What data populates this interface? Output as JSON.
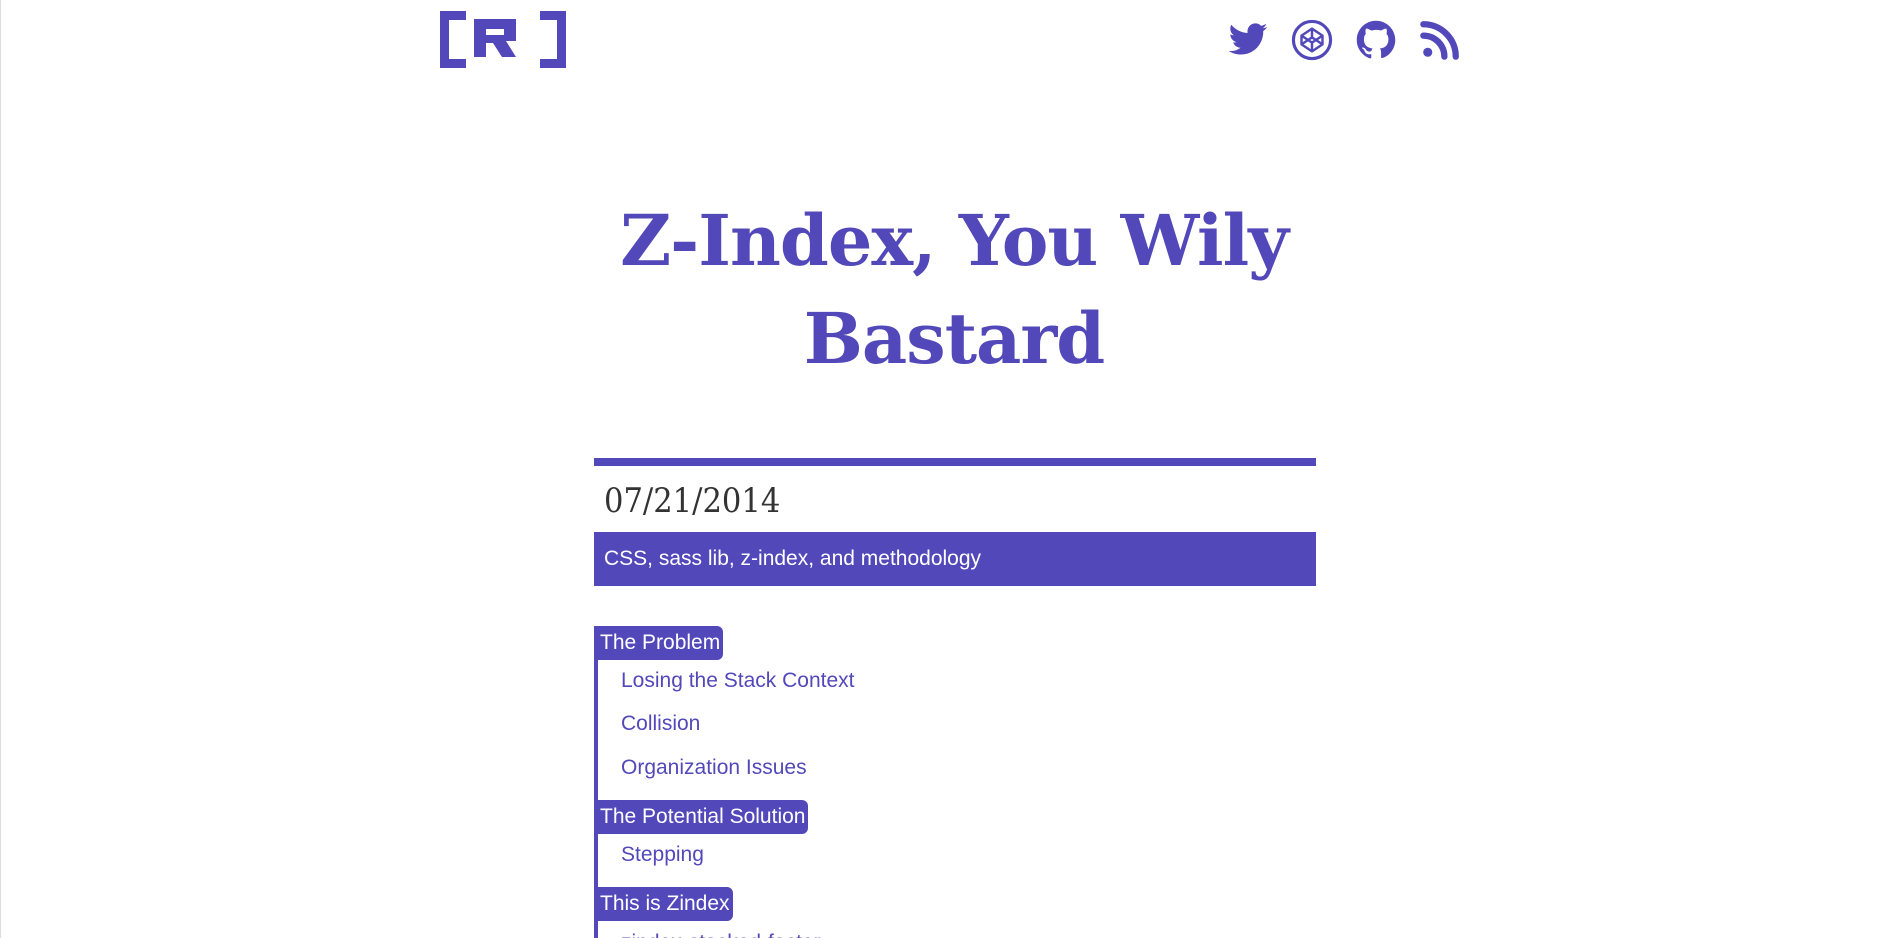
{
  "header": {
    "logo_label": "CR",
    "social": [
      {
        "name": "twitter",
        "icon": "twitter-icon"
      },
      {
        "name": "codepen",
        "icon": "codepen-icon"
      },
      {
        "name": "github",
        "icon": "github-icon"
      },
      {
        "name": "rss",
        "icon": "rss-icon"
      }
    ]
  },
  "colors": {
    "accent": "#5248ba",
    "text_dark": "#333333",
    "background": "#ffffff"
  },
  "post": {
    "title_line1": "Z-Index, You Wily",
    "title_line2": "Bastard",
    "date": "07/21/2014",
    "tags": "CSS, sass lib, z-index, and methodology"
  },
  "toc": [
    {
      "label": "The Problem",
      "level": 1
    },
    {
      "label": "Losing the Stack Context",
      "level": 2
    },
    {
      "label": "Collision",
      "level": 2
    },
    {
      "label": "Organization Issues",
      "level": 2
    },
    {
      "label": "The Potential Solution",
      "level": 1
    },
    {
      "label": "Stepping",
      "level": 2
    },
    {
      "label": "This is Zindex",
      "level": 1
    },
    {
      "label": "zindex-stacked-factor",
      "level": 2
    }
  ]
}
